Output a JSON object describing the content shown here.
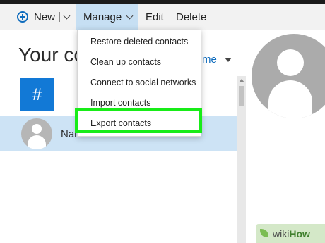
{
  "toolbar": {
    "new_label": "New",
    "manage_label": "Manage",
    "edit_label": "Edit",
    "delete_label": "Delete"
  },
  "content": {
    "title": "Your co",
    "sort_label": "me",
    "index_letter": "#"
  },
  "contact": {
    "name": "Name isn't available."
  },
  "manage_menu": {
    "items": [
      {
        "label": "Restore deleted contacts"
      },
      {
        "label": "Clean up contacts"
      },
      {
        "label": "Connect to social networks"
      },
      {
        "label": "Import contacts"
      },
      {
        "label": "Export contacts"
      }
    ],
    "highlighted": "Export contacts"
  },
  "watermark": {
    "part_a": "wiki",
    "part_b": "How"
  },
  "colors": {
    "accent": "#0f6cbd",
    "manage_active_bg": "#c6dff3",
    "selected_row_bg": "#cde3f5",
    "index_tile": "#1279d6",
    "highlight": "#18ec18"
  },
  "icons": [
    "plus-circle-icon",
    "chevron-down-icon",
    "caret-down-icon",
    "person-avatar-icon",
    "scroll-up-arrow-icon",
    "wikihow-leaf-icon"
  ]
}
